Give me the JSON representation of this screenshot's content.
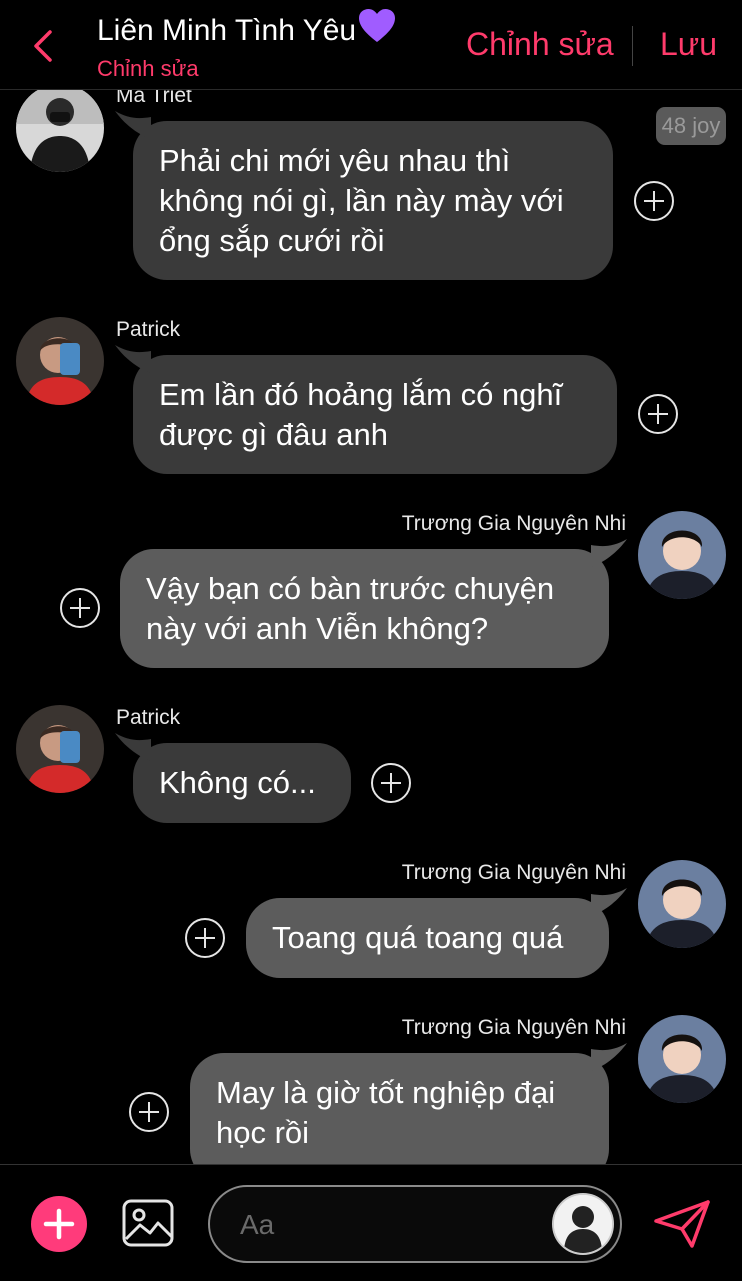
{
  "header": {
    "title": "Liên Minh Tình Yêu",
    "subtitle": "Chỉnh sửa",
    "edit_label": "Chỉnh sửa",
    "save_label": "Lưu"
  },
  "chat": {
    "badge": "48 joy",
    "messages": [
      {
        "sender": "Mã Triết",
        "side": "left",
        "lines": [
          "Phải chi mới yêu nhau thì",
          "không nói gì, lần này mày với",
          "ổng sắp cưới rồi"
        ]
      },
      {
        "sender": "Patrick",
        "side": "left",
        "lines": [
          "Em lần đó hoảng lắm có nghĩ",
          "được gì đâu anh"
        ]
      },
      {
        "sender": "Trương Gia Nguyên Nhi",
        "side": "right",
        "lines": [
          "Vậy bạn có bàn trước chuyện",
          "này với anh Viễn không?"
        ]
      },
      {
        "sender": "Patrick",
        "side": "left",
        "lines": [
          "Không có..."
        ]
      },
      {
        "sender": "Trương Gia Nguyên Nhi",
        "side": "right",
        "lines": [
          "Toang quá toang quá"
        ]
      },
      {
        "sender": "Trương Gia Nguyên Nhi",
        "side": "right",
        "lines": [
          "May là giờ tốt nghiệp đại",
          "học rồi"
        ]
      }
    ]
  },
  "composer": {
    "placeholder": "Aa"
  },
  "icons": {
    "back": "chevron-left-icon",
    "heart": "purple-heart-icon",
    "add": "plus-icon",
    "image": "image-icon",
    "send": "send-icon"
  },
  "colors": {
    "accent": "#ff3b6b",
    "bubble_left": "#3a3a3a",
    "bubble_right": "#5c5c5c",
    "heart": "#a05cff"
  }
}
